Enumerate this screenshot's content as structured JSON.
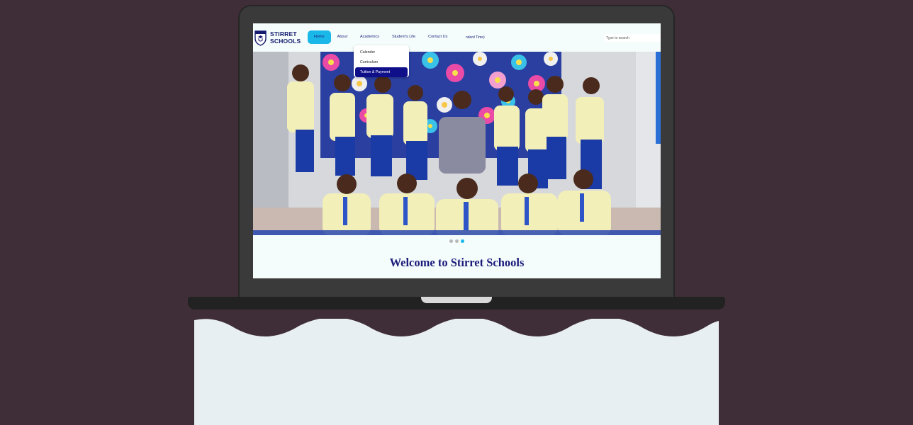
{
  "brand": {
    "line1": "STIRRET",
    "line2": "SCHOOLS"
  },
  "nav": {
    "items": [
      {
        "label": "Home"
      },
      {
        "label": "About"
      },
      {
        "label": "Academics"
      },
      {
        "label": "Student's Life"
      },
      {
        "label": "Contact Us"
      }
    ],
    "active": "Home",
    "time_text": "ndard Time)"
  },
  "search": {
    "placeholder": "Type to search"
  },
  "academics_menu": {
    "items": [
      {
        "label": "Calender"
      },
      {
        "label": "Curriculum"
      },
      {
        "label": "Tuition & Payment"
      }
    ],
    "highlighted": "Tuition & Payment"
  },
  "carousel": {
    "slide_count": 3,
    "active_index": 2
  },
  "welcome": {
    "heading": "Welcome to Stirret Schools"
  },
  "colors": {
    "background": "#3f2e37",
    "brand_navy": "#141a6e",
    "accent": "#1ab8e9",
    "menu_highlight": "#0f0f8a"
  }
}
